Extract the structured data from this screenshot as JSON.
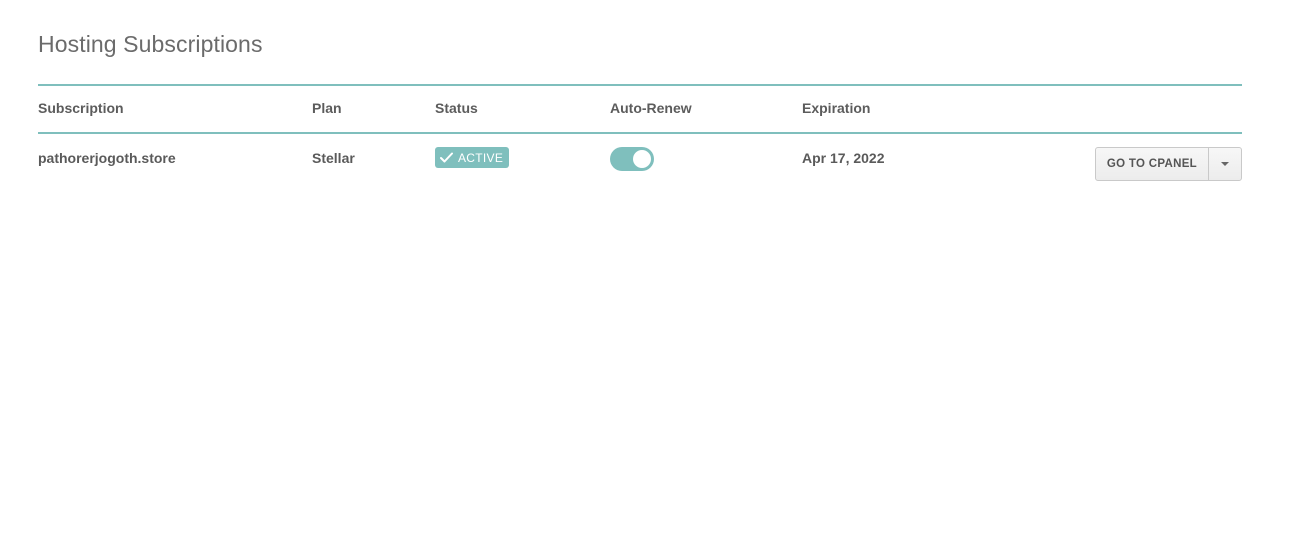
{
  "page": {
    "title": "Hosting Subscriptions"
  },
  "table": {
    "columns": [
      "Subscription",
      "Plan",
      "Status",
      "Auto-Renew",
      "Expiration"
    ],
    "rows": [
      {
        "subscription": "pathorerjogoth.store",
        "plan": "Stellar",
        "status": "ACTIVE",
        "auto_renew": true,
        "expiration": "Apr 17, 2022",
        "action_label": "GO TO CPANEL"
      }
    ]
  },
  "icons": {
    "status": "checkmark-icon",
    "action_menu": "chevron-down-icon"
  },
  "colors": {
    "accent": "#7fbfbd",
    "text": "#5a5a5a",
    "title": "#6b6b6b"
  }
}
